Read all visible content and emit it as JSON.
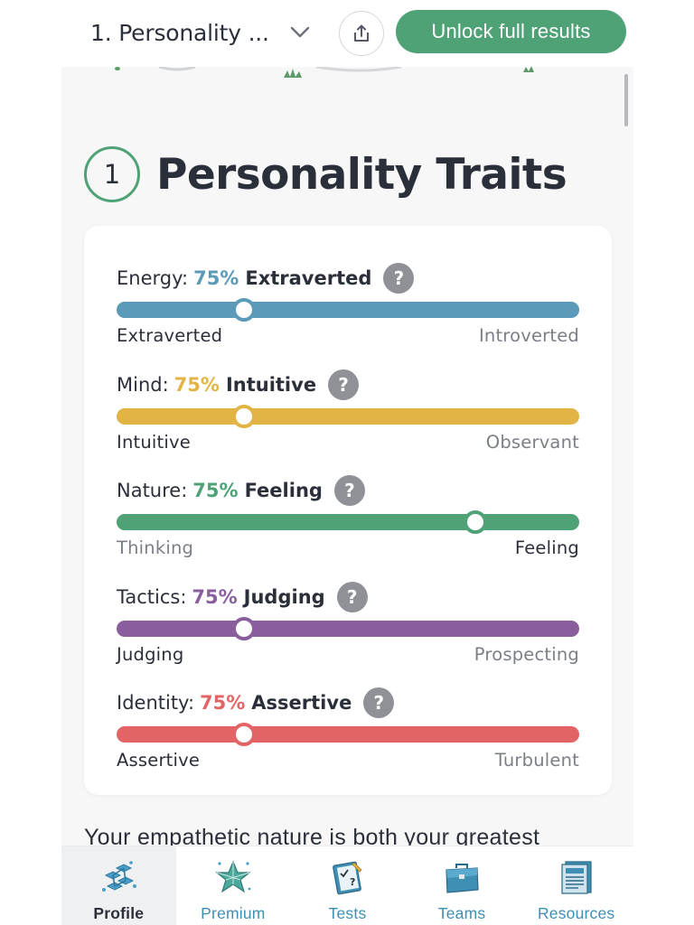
{
  "header": {
    "section_select": {
      "value": "1. Personality ...",
      "icon": "chevron-down-icon"
    },
    "share_icon": "share-icon",
    "unlock_label": "Unlock full results"
  },
  "section": {
    "number": "1",
    "title": "Personality Traits"
  },
  "traits": [
    {
      "name": "Energy:",
      "percent": "75%",
      "side": "Extraverted",
      "left_label": "Extraverted",
      "right_label": "Introverted",
      "color": "#5b9ab8",
      "knob_position": 0.275,
      "dominant": "left"
    },
    {
      "name": "Mind:",
      "percent": "75%",
      "side": "Intuitive",
      "left_label": "Intuitive",
      "right_label": "Observant",
      "color": "#e2b445",
      "knob_position": 0.275,
      "dominant": "left"
    },
    {
      "name": "Nature:",
      "percent": "75%",
      "side": "Feeling",
      "left_label": "Thinking",
      "right_label": "Feeling",
      "color": "#4ea276",
      "knob_position": 0.775,
      "dominant": "right"
    },
    {
      "name": "Tactics:",
      "percent": "75%",
      "side": "Judging",
      "left_label": "Judging",
      "right_label": "Prospecting",
      "color": "#8a5d9e",
      "knob_position": 0.275,
      "dominant": "left"
    },
    {
      "name": "Identity:",
      "percent": "75%",
      "side": "Assertive",
      "left_label": "Assertive",
      "right_label": "Turbulent",
      "color": "#e36464",
      "knob_position": 0.275,
      "dominant": "left"
    }
  ],
  "help_glyph": "?",
  "body_text": "Your empathetic nature is both your greatest",
  "nav": [
    {
      "label": "Profile",
      "icon": "profile-icon",
      "active": true
    },
    {
      "label": "Premium",
      "icon": "premium-icon",
      "active": false
    },
    {
      "label": "Tests",
      "icon": "tests-icon",
      "active": false
    },
    {
      "label": "Teams",
      "icon": "teams-icon",
      "active": false
    },
    {
      "label": "Resources",
      "icon": "resources-icon",
      "active": false
    }
  ]
}
